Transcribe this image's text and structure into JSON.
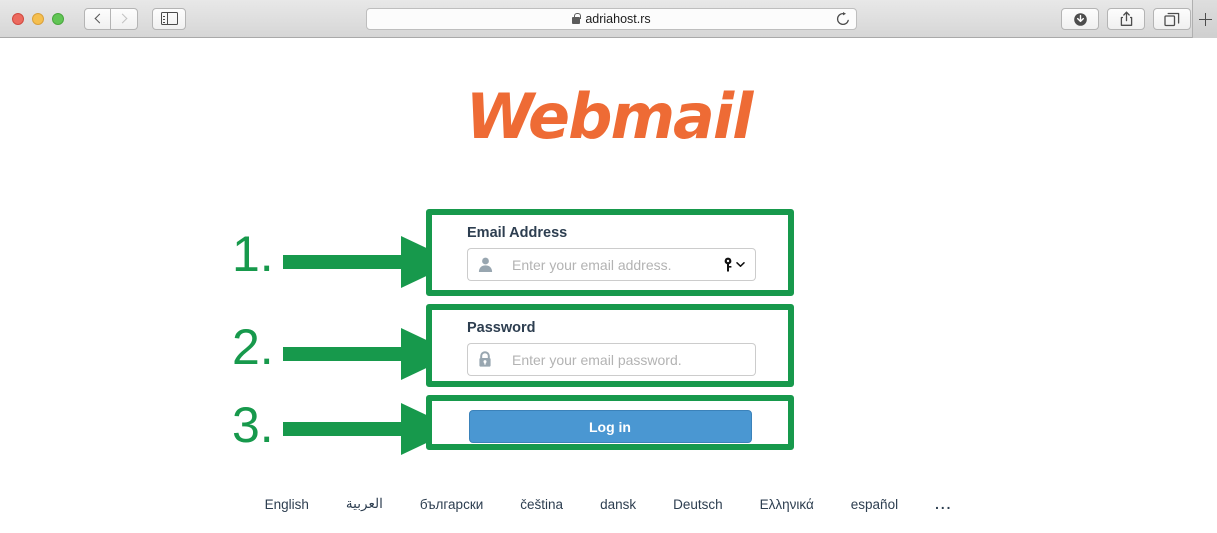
{
  "browser": {
    "window_controls": [
      "close",
      "minimize",
      "maximize"
    ],
    "back_label": "Back",
    "forward_label": "Forward",
    "sidebar_label": "Show Sidebar",
    "address": "adriahost.rs",
    "secure": true,
    "reload_label": "Reload",
    "downloads_label": "Downloads",
    "share_label": "Share",
    "tabs_label": "Show All Tabs",
    "newtab_label": "New Tab"
  },
  "page": {
    "logo_text": "Webmail",
    "logo_color": "#ee6b35",
    "email": {
      "label": "Email Address",
      "placeholder": "Enter your email address.",
      "value": "",
      "icon": "user-icon",
      "autofill_icon": "key-icon"
    },
    "password": {
      "label": "Password",
      "placeholder": "Enter your email password.",
      "value": "",
      "icon": "lock-icon"
    },
    "login_button": {
      "label": "Log in",
      "color": "#4a97d2"
    },
    "languages": [
      "English",
      "العربية",
      "български",
      "čeština",
      "dansk",
      "Deutsch",
      "Ελληνικά",
      "español",
      "..."
    ]
  },
  "annotations": {
    "color": "#17994c",
    "steps": [
      {
        "number": "1.",
        "target": "email-address-field"
      },
      {
        "number": "2.",
        "target": "password-field"
      },
      {
        "number": "3.",
        "target": "login-button"
      }
    ]
  }
}
